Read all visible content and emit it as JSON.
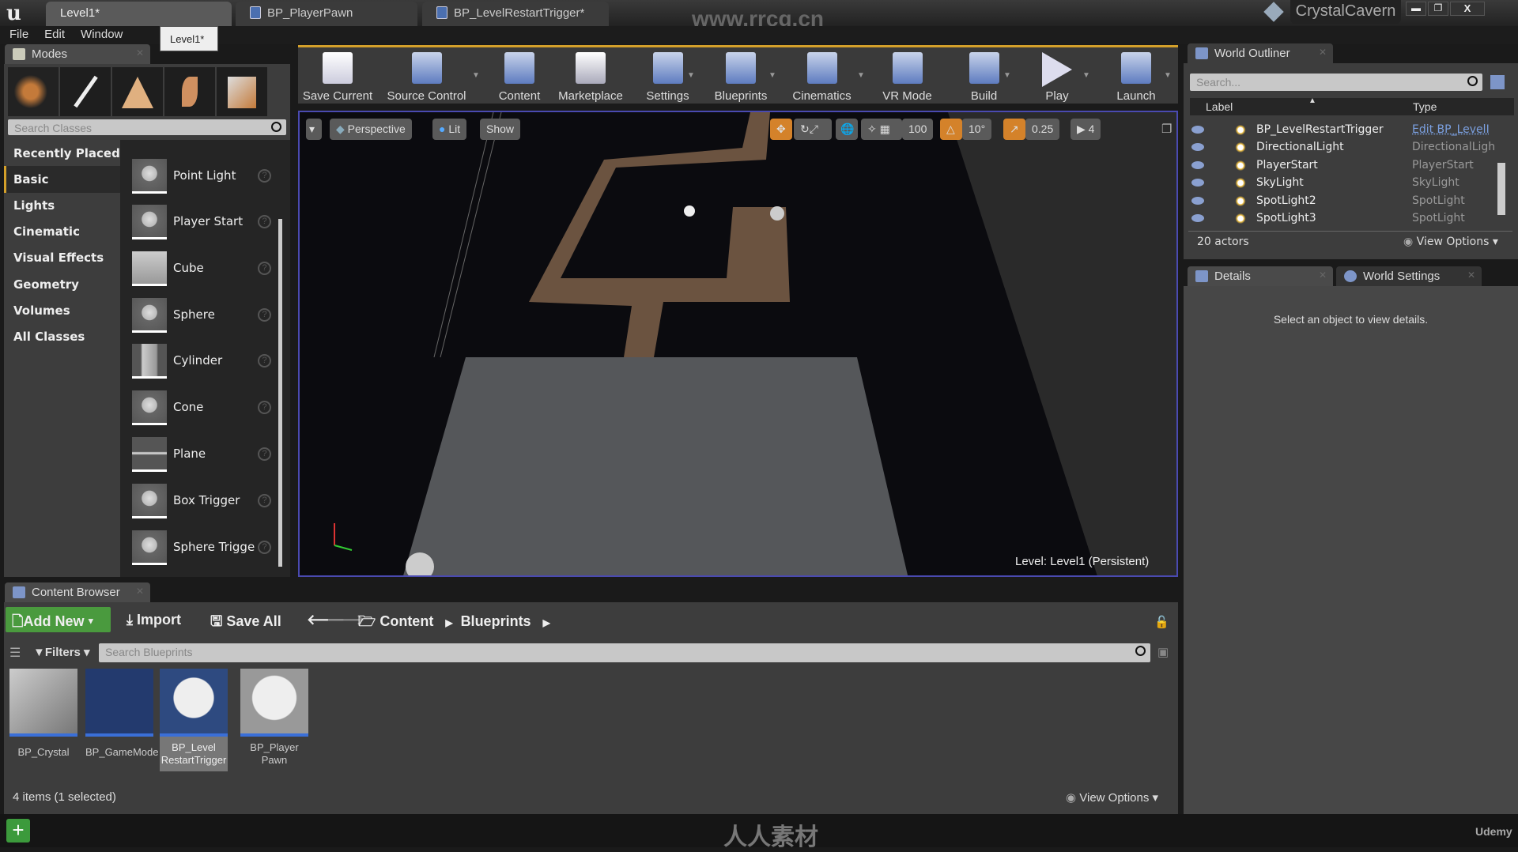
{
  "titlebar": {
    "tabs": [
      "Level1*",
      "BP_PlayerPawn",
      "BP_LevelRestartTrigger*"
    ],
    "project": "CrystalCavern",
    "watermark": "www.rrcg.cn",
    "window_controls": [
      "minimize",
      "restore",
      "close"
    ]
  },
  "menu": [
    "File",
    "Edit",
    "Window"
  ],
  "tooltip": "Level1*",
  "modes": {
    "tab": "Modes",
    "search_placeholder": "Search Classes",
    "categories": [
      "Recently Placed",
      "Basic",
      "Lights",
      "Cinematic",
      "Visual Effects",
      "Geometry",
      "Volumes",
      "All Classes"
    ],
    "selected_category": "Basic",
    "classes": [
      "Point Light",
      "Player Start",
      "Cube",
      "Sphere",
      "Cylinder",
      "Cone",
      "Plane",
      "Box Trigger",
      "Sphere Trigge"
    ]
  },
  "toolbar": [
    "Save Current",
    "Source Control",
    "Content",
    "Marketplace",
    "Settings",
    "Blueprints",
    "Cinematics",
    "VR Mode",
    "Build",
    "Play",
    "Launch"
  ],
  "viewport": {
    "perspective": "Perspective",
    "lit": "Lit",
    "show": "Show",
    "grid_snap": "100",
    "rotate_snap": "10°",
    "scale_snap": "0.25",
    "camera_speed": "4",
    "level_label": "Level:",
    "level_name": "Level1 (Persistent)",
    "accent": "#d4822a"
  },
  "outliner": {
    "tab": "World Outliner",
    "search_placeholder": "Search...",
    "col_label": "Label",
    "col_type": "Type",
    "rows": [
      {
        "label": "BP_LevelRestartTrigger",
        "type": "Edit BP_LevelI"
      },
      {
        "label": "DirectionalLight",
        "type": "DirectionalLigh"
      },
      {
        "label": "PlayerStart",
        "type": "PlayerStart"
      },
      {
        "label": "SkyLight",
        "type": "SkyLight"
      },
      {
        "label": "SpotLight2",
        "type": "SpotLight"
      },
      {
        "label": "SpotLight3",
        "type": "SpotLight"
      }
    ],
    "count": "20 actors",
    "view_options": "View Options"
  },
  "details": {
    "tab": "Details",
    "tab2": "World Settings",
    "empty": "Select an object to view details."
  },
  "content_browser": {
    "tab": "Content Browser",
    "add_new": "Add New",
    "import": "Import",
    "save_all": "Save All",
    "path": [
      "Content",
      "Blueprints"
    ],
    "filters": "Filters",
    "search_placeholder": "Search Blueprints",
    "assets": [
      "BP_Crystal",
      "BP_GameMode",
      "BP_Level RestartTrigger",
      "BP_Player Pawn"
    ],
    "selected_asset": "BP_Level RestartTrigger",
    "status": "4 items (1 selected)",
    "view_options": "View Options"
  },
  "footer": {
    "watermark": "人人素材",
    "brand": "Udemy"
  }
}
